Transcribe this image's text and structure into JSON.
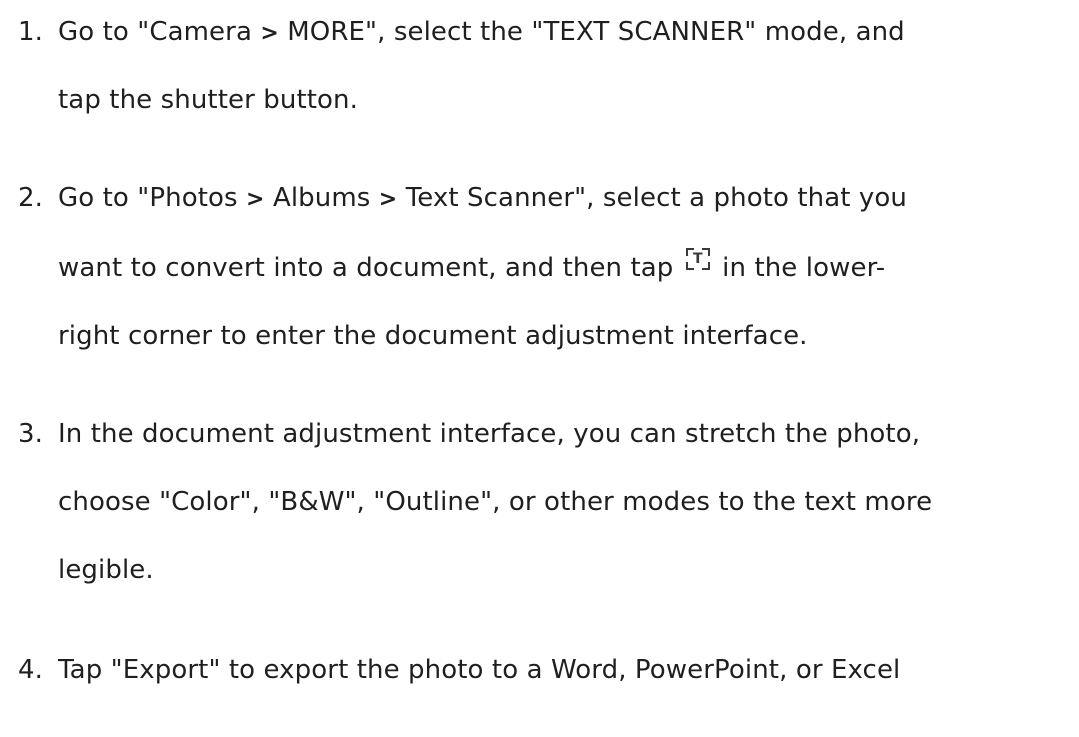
{
  "steps": [
    {
      "number": "1.",
      "lines": [
        {
          "segments": [
            "Go to \"Camera ",
            ">",
            " MORE\", select the \"TEXT SCANNER\" mode, and"
          ]
        },
        {
          "text": "tap the shutter button."
        }
      ]
    },
    {
      "number": "2.",
      "lines": [
        {
          "segments": [
            "Go to \"Photos ",
            ">",
            " Albums ",
            ">",
            " Text Scanner\", select a photo that you"
          ]
        },
        {
          "before_icon": "want to convert into a document, and then tap",
          "icon": "text-scan-icon",
          "icon_glyph": "T",
          "after_icon": "in the lower-"
        },
        {
          "text": "right corner to enter the document adjustment interface."
        }
      ]
    },
    {
      "number": "3.",
      "lines": [
        {
          "text": "In the document adjustment interface, you can stretch the photo,"
        },
        {
          "text": "choose \"Color\", \"B&W\", \"Outline\", or other modes to the text more"
        },
        {
          "text": "legible."
        }
      ]
    },
    {
      "number": "4.",
      "lines": [
        {
          "text": "Tap \"Export\" to export the photo to a Word, PowerPoint, or Excel"
        }
      ]
    }
  ]
}
